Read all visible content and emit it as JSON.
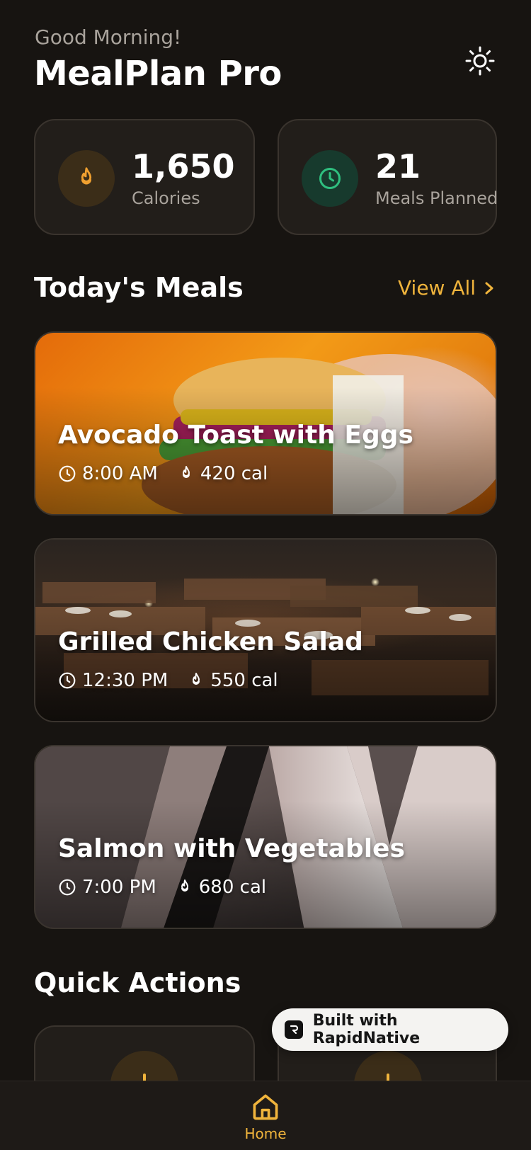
{
  "header": {
    "greeting": "Good Morning!",
    "title": "MealPlan Pro",
    "theme_icon": "sun-icon"
  },
  "stats": [
    {
      "value": "1,650",
      "label": "Calories",
      "icon": "flame-icon",
      "color": "#f0a030"
    },
    {
      "value": "21",
      "label": "Meals Planned",
      "icon": "clock-icon",
      "color": "#2fbf7f"
    }
  ],
  "todays_meals": {
    "title": "Today's Meals",
    "view_all": "View All",
    "items": [
      {
        "name": "Avocado Toast with Eggs",
        "time": "8:00 AM",
        "calories": "420 cal"
      },
      {
        "name": "Grilled Chicken Salad",
        "time": "12:30 PM",
        "calories": "550 cal"
      },
      {
        "name": "Salmon with Vegetables",
        "time": "7:00 PM",
        "calories": "680 cal"
      }
    ]
  },
  "quick_actions": {
    "title": "Quick Actions"
  },
  "badge": {
    "label": "Built with RapidNative"
  },
  "tabbar": {
    "home_label": "Home",
    "accent": "#f0b43c"
  }
}
